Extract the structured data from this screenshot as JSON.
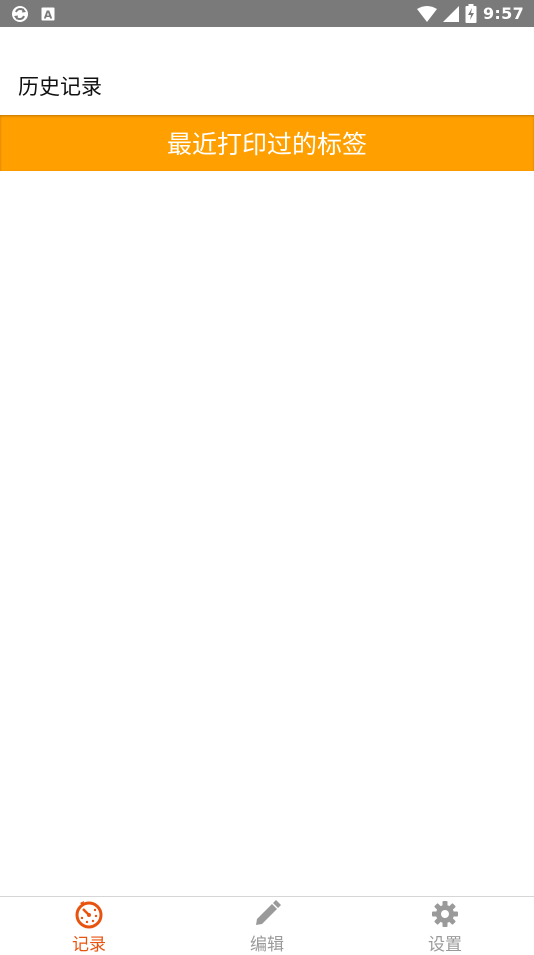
{
  "status_bar": {
    "time": "9:57",
    "left_icons": [
      "sync-icon",
      "notification-a-icon"
    ],
    "right_icons": [
      "wifi-icon",
      "cellular-signal-icon",
      "battery-charging-icon"
    ]
  },
  "header": {
    "title": "历史记录"
  },
  "banner": {
    "label": "最近打印过的标签",
    "color": "#ff9f00"
  },
  "history_list": {
    "items": []
  },
  "bottom_nav": {
    "active_color": "#e8530f",
    "inactive_color": "#9a9a9a",
    "items": [
      {
        "label": "记录",
        "icon": "history-icon",
        "active": true
      },
      {
        "label": "编辑",
        "icon": "pencil-icon",
        "active": false
      },
      {
        "label": "设置",
        "icon": "gear-icon",
        "active": false
      }
    ]
  }
}
